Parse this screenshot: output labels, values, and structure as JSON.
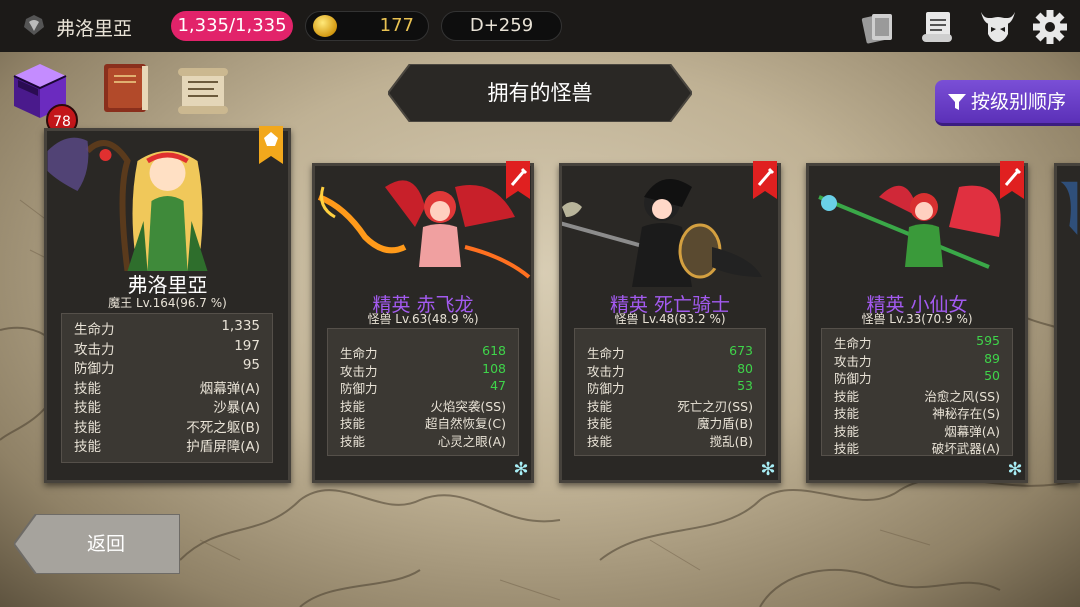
{
  "topbar": {
    "player_name": "弗洛里亞",
    "hp": "1,335/1,335",
    "gold": "177",
    "day": "D+259",
    "icons": [
      "cards-icon",
      "quest-scroll-icon",
      "demon-skull-icon",
      "gear-icon"
    ]
  },
  "header": {
    "chest_badge": "78",
    "title": "拥有的怪兽",
    "sort_label": "按级别顺序"
  },
  "cards": [
    {
      "name": "弗洛里亞",
      "sub": "魔王 Lv.164(96.7 %)",
      "stats": [
        {
          "label": "生命力",
          "value": "1,335"
        },
        {
          "label": "攻击力",
          "value": "197"
        },
        {
          "label": "防御力",
          "value": "95"
        },
        {
          "label": "技能",
          "value": "烟幕弹(A)"
        },
        {
          "label": "技能",
          "value": "沙暴(A)"
        },
        {
          "label": "技能",
          "value": "不死之躯(B)"
        },
        {
          "label": "技能",
          "value": "护盾屏障(A)"
        }
      ]
    },
    {
      "name": "精英 赤飞龙",
      "sub": "怪兽 Lv.63(48.9 %)",
      "stats": [
        {
          "label": "生命力",
          "value": "618"
        },
        {
          "label": "攻击力",
          "value": "108"
        },
        {
          "label": "防御力",
          "value": "47"
        },
        {
          "label": "技能",
          "value": "火焰突袭(SS)"
        },
        {
          "label": "技能",
          "value": "超自然恢复(C)"
        },
        {
          "label": "技能",
          "value": "心灵之眼(A)"
        }
      ]
    },
    {
      "name": "精英 死亡骑士",
      "sub": "怪兽 Lv.48(83.2 %)",
      "stats": [
        {
          "label": "生命力",
          "value": "673"
        },
        {
          "label": "攻击力",
          "value": "80"
        },
        {
          "label": "防御力",
          "value": "53"
        },
        {
          "label": "技能",
          "value": "死亡之刃(SS)"
        },
        {
          "label": "技能",
          "value": "魔力盾(B)"
        },
        {
          "label": "技能",
          "value": "搅乱(B)"
        }
      ]
    },
    {
      "name": "精英 小仙女",
      "sub": "怪兽 Lv.33(70.9 %)",
      "stats": [
        {
          "label": "生命力",
          "value": "595"
        },
        {
          "label": "攻击力",
          "value": "89"
        },
        {
          "label": "防御力",
          "value": "50"
        },
        {
          "label": "技能",
          "value": "治愈之风(SS)"
        },
        {
          "label": "技能",
          "value": "神秘存在(S)"
        },
        {
          "label": "技能",
          "value": "烟幕弹(A)"
        },
        {
          "label": "技能",
          "value": "破坏武器(A)"
        }
      ]
    }
  ],
  "footer": {
    "back_label": "返回"
  },
  "colors": {
    "elite_name": "#a35af0",
    "stat_green": "#3fd44a",
    "hp_pill": "#e2236a",
    "sort_button": "#6a3fc9"
  }
}
